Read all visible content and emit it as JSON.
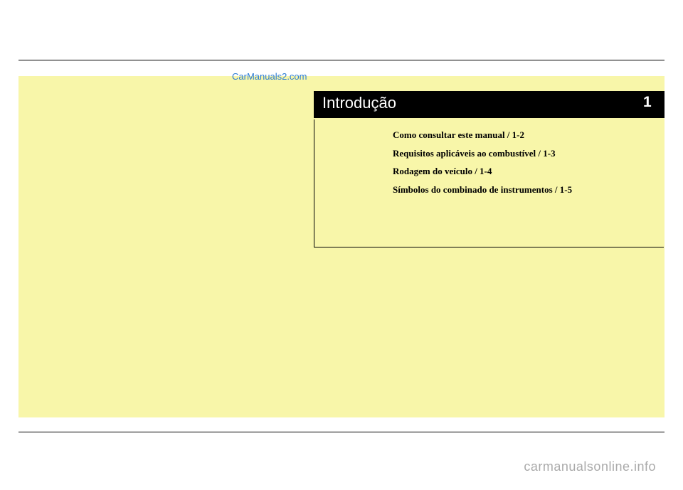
{
  "watermarks": {
    "top": "CarManuals2.com",
    "bottom": "carmanualsonline.info"
  },
  "chapter": {
    "title": "Introdução",
    "number": "1"
  },
  "toc": {
    "entries": [
      "Como consultar este manual / 1-2",
      "Requisitos aplicáveis ao combustível / 1-3",
      "Rodagem do veículo / 1-4",
      "Símbolos do combinado de instrumentos / 1-5"
    ]
  }
}
